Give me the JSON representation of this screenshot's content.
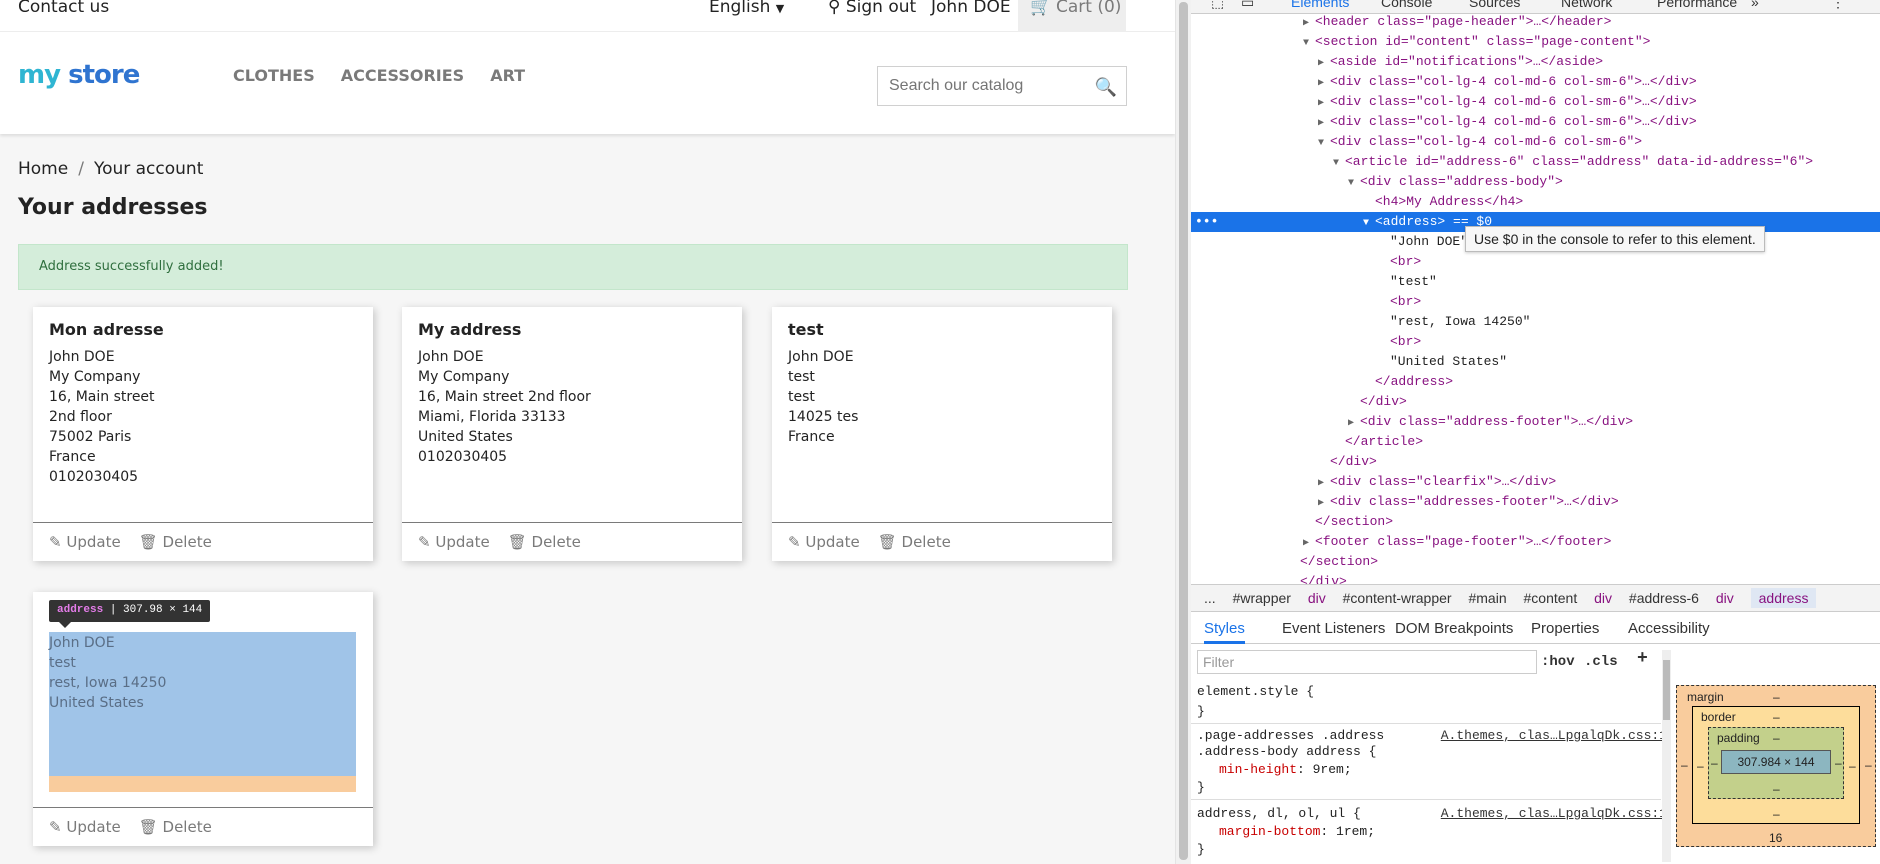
{
  "store": {
    "nav": {
      "contact": "Contact us",
      "language": "English",
      "sign_out": "Sign out",
      "user": "John DOE",
      "cart": "Cart (0)"
    },
    "logo": {
      "part1": "my",
      "part2": " store"
    },
    "menu": [
      "CLOTHES",
      "ACCESSORIES",
      "ART"
    ],
    "search_placeholder": "Search our catalog",
    "breadcrumb": [
      "Home",
      "Your account"
    ],
    "page_title": "Your addresses",
    "alert": "Address successfully added!",
    "addresses": [
      {
        "title": "Mon adresse",
        "lines": [
          "John DOE",
          "My Company",
          "16, Main street",
          "2nd floor",
          "75002 Paris",
          "France",
          "0102030405"
        ]
      },
      {
        "title": "My address",
        "lines": [
          "John DOE",
          "My Company",
          "16, Main street 2nd floor",
          "Miami, Florida 33133",
          "United States",
          "0102030405"
        ]
      },
      {
        "title": "test",
        "lines": [
          "John DOE",
          "test",
          "test",
          "14025 tes",
          "France"
        ]
      },
      {
        "title": "",
        "lines": [
          "John DOE",
          "test",
          "rest, Iowa 14250",
          "United States"
        ]
      }
    ],
    "update_label": "Update",
    "delete_label": "Delete",
    "inspect_tooltip": {
      "tag": "address",
      "size": "307.98 × 144"
    }
  },
  "devtools": {
    "tabs": [
      "Elements",
      "Console",
      "Sources",
      "Network",
      "Performance",
      "»"
    ],
    "hint": "Use $0 in the console to refer to this element.",
    "breadcrumb": [
      "...",
      "#wrapper",
      "div",
      "#content-wrapper",
      "#main",
      "#content",
      "div",
      "#address-6",
      "div",
      "address"
    ],
    "subtabs": [
      "Styles",
      "Event Listeners",
      "DOM Breakpoints",
      "Properties",
      "Accessibility"
    ],
    "filter_placeholder": "Filter",
    "hov": ":hov",
    "cls": ".cls",
    "plus": "+",
    "rules": {
      "r1": "element.style {",
      "r1_close": "}",
      "r2_sel1": ".page-addresses .address",
      "r2_sel2": ".address-body address {",
      "r2_prop": "min-height",
      "r2_val": ": 9rem;",
      "r2_close": "}",
      "r2_src": "A.themes,_clas…LpgalqDk.css:1",
      "r3_sel": "address, dl, ol, ul {",
      "r3_prop": "margin-bottom",
      "r3_val": ": 1rem;",
      "r3_close": "}",
      "r3_src": "A.themes,_clas…LpgalqDk.css:1"
    },
    "boxmodel": {
      "margin": "margin",
      "border": "border",
      "padding": "padding",
      "content": "307.984 × 144",
      "dash": "–",
      "margin_bottom": "16"
    },
    "tree": [
      "<header class=\"page-header\">…</header>",
      "<section id=\"content\" class=\"page-content\">",
      "<aside id=\"notifications\">…</aside>",
      "<div class=\"col-lg-4 col-md-6 col-sm-6\">…</div>",
      "<div class=\"col-lg-4 col-md-6 col-sm-6\">…</div>",
      "<div class=\"col-lg-4 col-md-6 col-sm-6\">…</div>",
      "<div class=\"col-lg-4 col-md-6 col-sm-6\">",
      "<article id=\"address-6\" class=\"address\" data-id-address=\"6\">",
      "<div class=\"address-body\">",
      "<h4>My Address</h4>",
      "<address> == $0",
      "\"John DOE\"",
      "<br>",
      "\"test\"",
      "<br>",
      "\"rest, Iowa 14250\"",
      "<br>",
      "\"United States\"",
      "</address>",
      "</div>",
      "<div class=\"address-footer\">…</div>",
      "</article>",
      "</div>",
      "<div class=\"clearfix\">…</div>",
      "<div class=\"addresses-footer\">…</div>",
      "</section>",
      "<footer class=\"page-footer\">…</footer>",
      "</section>",
      "</div>"
    ]
  }
}
